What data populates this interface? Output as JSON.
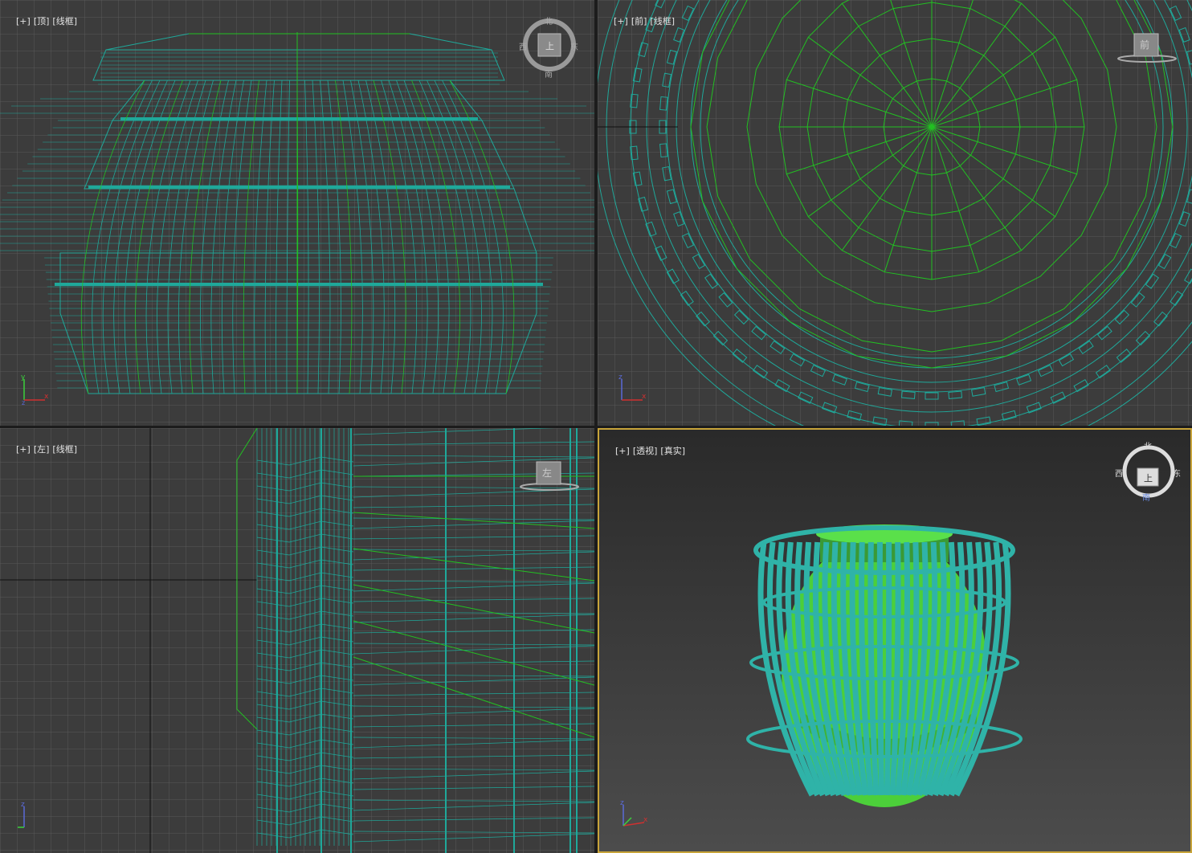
{
  "viewports": {
    "top": {
      "labels": [
        "[+]",
        "[顶]",
        "[线框]"
      ],
      "compass": {
        "north": "北",
        "south": "南",
        "east": "东",
        "west": "西",
        "face": "上"
      }
    },
    "front": {
      "labels": [
        "[+]",
        "[前]",
        "[线框]"
      ],
      "cube_face": "前"
    },
    "left": {
      "labels": [
        "[+]",
        "[左]",
        "[线框]"
      ],
      "cube_face": "左"
    },
    "perspective": {
      "labels": [
        "[+]",
        "[透视]",
        "[真实]"
      ],
      "compass": {
        "north": "北",
        "south": "南",
        "east": "东",
        "west": "西",
        "face": "上"
      }
    }
  },
  "axes": {
    "x": "x",
    "y": "y",
    "z": "z"
  },
  "colors": {
    "grid": "#595959",
    "wire_cyan": "#1fa89a",
    "wire_green": "#22c022",
    "viewport_bg": "#3c3c3c",
    "active_border": "#c8a43a",
    "body_green": "#4ccf3a"
  }
}
